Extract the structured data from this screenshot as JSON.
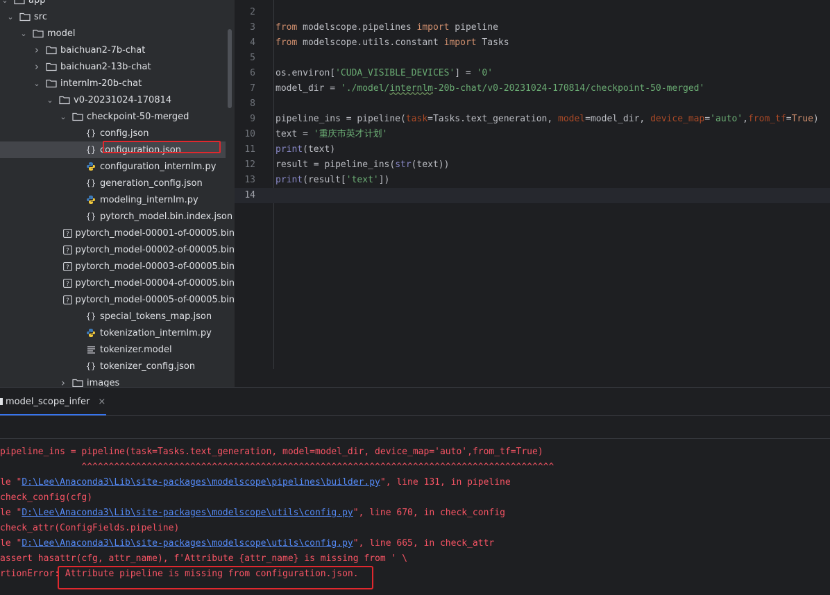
{
  "project_tree": {
    "items": [
      {
        "label": "app",
        "depth": 2,
        "kind": "folder",
        "expanded": true
      },
      {
        "label": "src",
        "depth": 3,
        "kind": "folder",
        "expanded": true
      },
      {
        "label": "model",
        "depth": 4,
        "kind": "folder",
        "expanded": true
      },
      {
        "label": "baichuan2-7b-chat",
        "depth": 5,
        "kind": "folder",
        "expanded": false
      },
      {
        "label": "baichuan2-13b-chat",
        "depth": 5,
        "kind": "folder",
        "expanded": false
      },
      {
        "label": "internlm-20b-chat",
        "depth": 5,
        "kind": "folder",
        "expanded": true
      },
      {
        "label": "v0-20231024-170814",
        "depth": 6,
        "kind": "folder",
        "expanded": true
      },
      {
        "label": "checkpoint-50-merged",
        "depth": 7,
        "kind": "folder",
        "expanded": true
      },
      {
        "label": "config.json",
        "depth": 8,
        "kind": "json"
      },
      {
        "label": "configuration.json",
        "depth": 8,
        "kind": "json",
        "selected": true
      },
      {
        "label": "configuration_internlm.py",
        "depth": 8,
        "kind": "python"
      },
      {
        "label": "generation_config.json",
        "depth": 8,
        "kind": "json"
      },
      {
        "label": "modeling_internlm.py",
        "depth": 8,
        "kind": "python"
      },
      {
        "label": "pytorch_model.bin.index.json",
        "depth": 8,
        "kind": "json"
      },
      {
        "label": "pytorch_model-00001-of-00005.bin",
        "depth": 8,
        "kind": "unknown"
      },
      {
        "label": "pytorch_model-00002-of-00005.bin",
        "depth": 8,
        "kind": "unknown"
      },
      {
        "label": "pytorch_model-00003-of-00005.bin",
        "depth": 8,
        "kind": "unknown"
      },
      {
        "label": "pytorch_model-00004-of-00005.bin",
        "depth": 8,
        "kind": "unknown"
      },
      {
        "label": "pytorch_model-00005-of-00005.bin",
        "depth": 8,
        "kind": "unknown"
      },
      {
        "label": "special_tokens_map.json",
        "depth": 8,
        "kind": "json"
      },
      {
        "label": "tokenization_internlm.py",
        "depth": 8,
        "kind": "python"
      },
      {
        "label": "tokenizer.model",
        "depth": 8,
        "kind": "text"
      },
      {
        "label": "tokenizer_config.json",
        "depth": 8,
        "kind": "json"
      },
      {
        "label": "images",
        "depth": 7,
        "kind": "folder",
        "expanded": false
      }
    ]
  },
  "editor": {
    "current_line": 14,
    "lines": [
      {
        "n": "2",
        "html": ""
      },
      {
        "n": "3",
        "html": "<span class=\"kw\">from</span> modelscope.pipelines <span class=\"kw\">import</span> pipeline"
      },
      {
        "n": "4",
        "html": "<span class=\"kw\">from</span> modelscope.utils.constant <span class=\"kw\">import</span> Tasks"
      },
      {
        "n": "5",
        "html": ""
      },
      {
        "n": "6",
        "html": "os.environ[<span class=\"str\">'CUDA_VISIBLE_DEVICES'</span>] = <span class=\"str\">'0'</span>"
      },
      {
        "n": "7",
        "html": "model_dir = <span class=\"str\">'./model/<span class=\"ul\">internlm</span>-20b-chat/v0-20231024-170814/checkpoint-50-merged'</span>"
      },
      {
        "n": "8",
        "html": ""
      },
      {
        "n": "9",
        "html": "pipeline_ins = pipeline(<span class=\"param\">task</span>=Tasks.text_generation, <span class=\"param\">model</span>=model_dir, <span class=\"param\">device_map</span>=<span class=\"str\">'auto'</span>,<span class=\"param\">from_tf</span>=<span class=\"kw\">True</span>)"
      },
      {
        "n": "10",
        "html": "text = <span class=\"str\">'重庆市英才计划'</span>"
      },
      {
        "n": "11",
        "html": "<span class=\"builtin\">print</span>(text)"
      },
      {
        "n": "12",
        "html": "result = pipeline_ins(<span class=\"builtin\">str</span>(text))"
      },
      {
        "n": "13",
        "html": "<span class=\"builtin\">print</span>(result[<span class=\"str\">'text'</span>])"
      },
      {
        "n": "14",
        "html": ""
      }
    ]
  },
  "run_panel": {
    "tab_label": "model_scope_infer",
    "close_glyph": "×",
    "output": [
      {
        "html": "pipeline_ins = pipeline(task=Tasks.text_generation, model=model_dir, device_map='auto',from_tf=True)"
      },
      {
        "html": "               ^^^^^^^^^^^^^^^^^^^^^^^^^^^^^^^^^^^^^^^^^^^^^^^^^^^^^^^^^^^^^^^^^^^^^^^^^^^^^^^^^^^^^^^"
      },
      {
        "html": "le \"<a>D:\\Lee\\Anaconda3\\Lib\\site-packages\\modelscope\\pipelines\\builder.py</a>\", line 131, in pipeline"
      },
      {
        "html": "check_config(cfg)"
      },
      {
        "html": "le \"<a>D:\\Lee\\Anaconda3\\Lib\\site-packages\\modelscope\\utils\\config.py</a>\", line 670, in check_config"
      },
      {
        "html": "check_attr(ConfigFields.pipeline)"
      },
      {
        "html": "le \"<a>D:\\Lee\\Anaconda3\\Lib\\site-packages\\modelscope\\utils\\config.py</a>\", line 665, in check_attr"
      },
      {
        "html": "assert hasattr(cfg, attr_name), f'Attribute {attr_name} is missing from ' \\"
      },
      {
        "html": "rtionError: Attribute pipeline is missing from configuration.json."
      }
    ]
  },
  "colors": {
    "error_text": "#f75464",
    "link": "#548af7",
    "highlight_box": "#e0282e",
    "editor_bg": "#1e1f22",
    "tree_bg": "#2b2d30"
  }
}
